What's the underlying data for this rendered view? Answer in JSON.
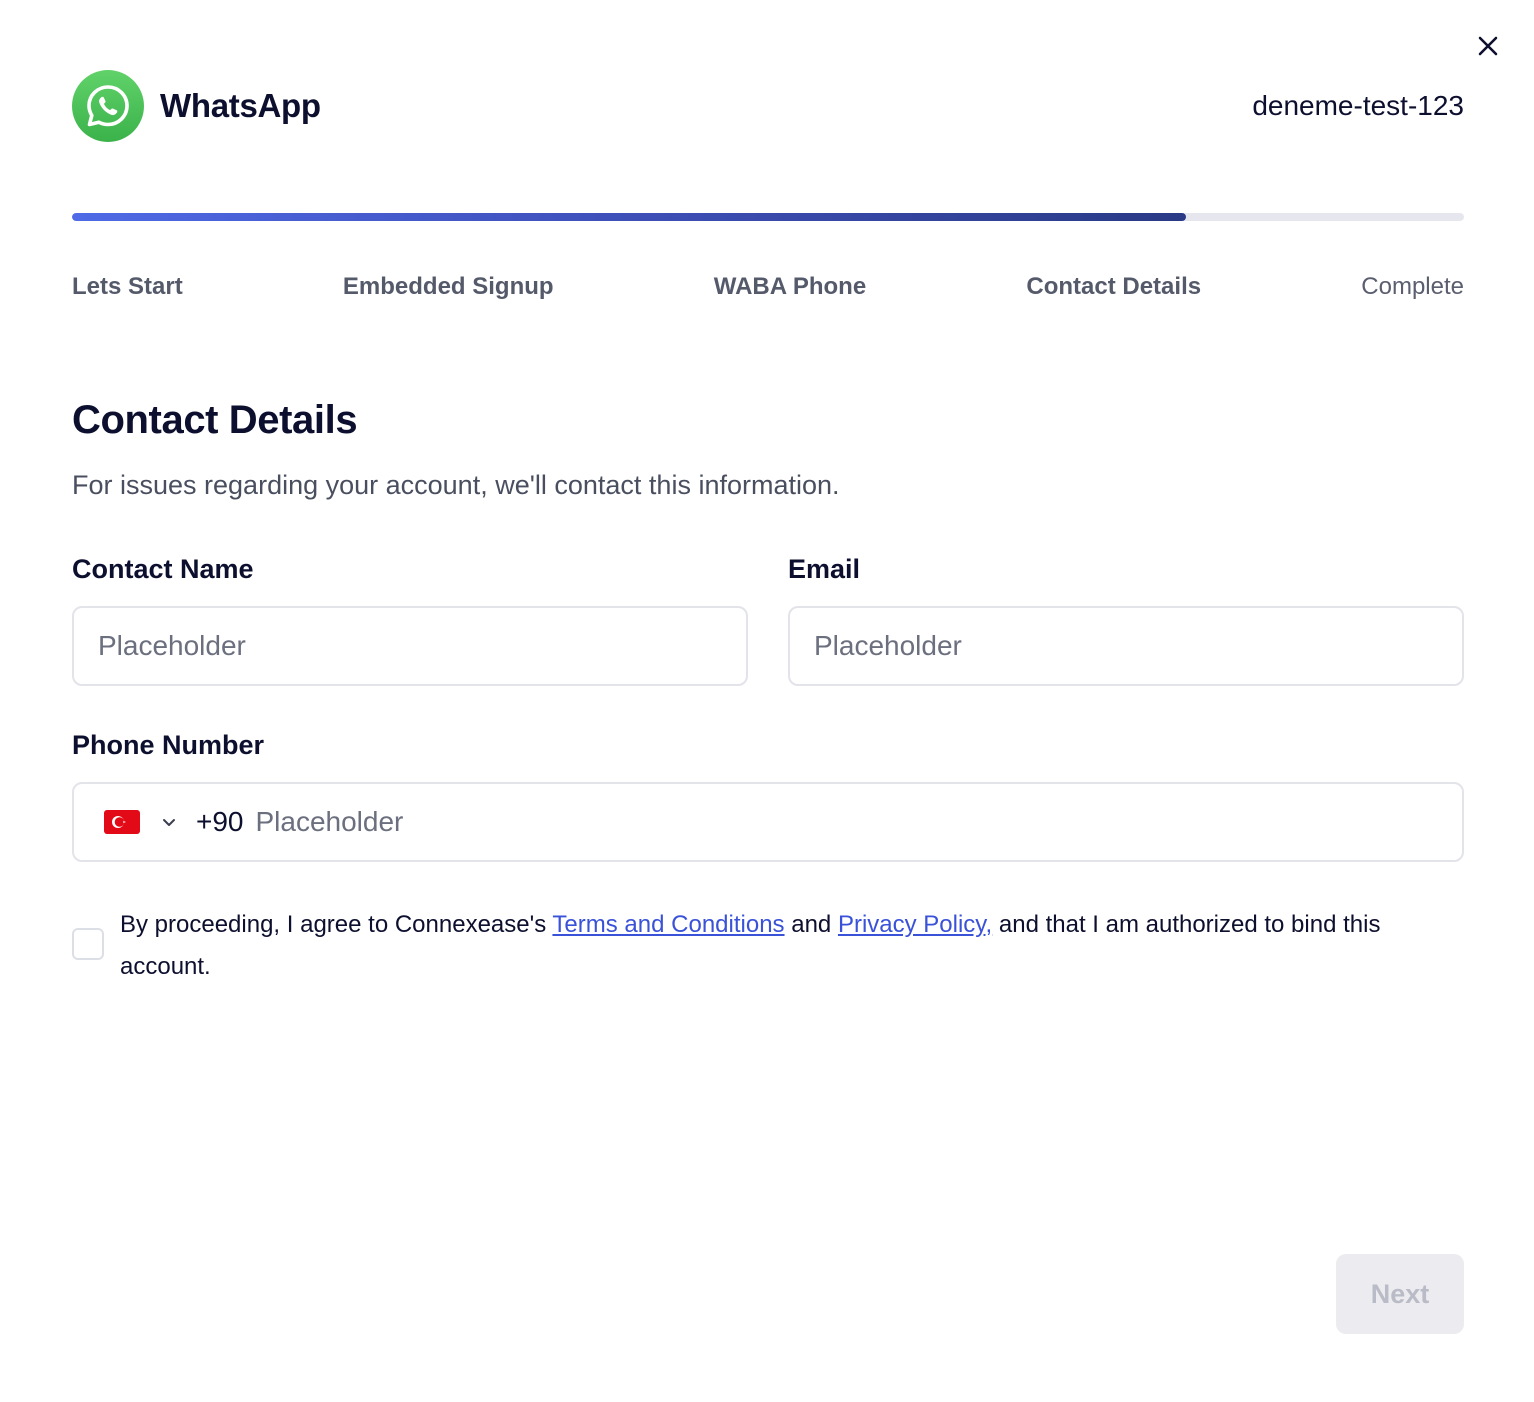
{
  "header": {
    "app_name": "WhatsApp",
    "account_name": "deneme-test-123",
    "logo_icon": "whatsapp-logo-icon",
    "close_icon": "close-icon"
  },
  "progress": {
    "current_step": 4,
    "total_steps": 5,
    "fraction_complete": 0.8,
    "steps": [
      {
        "label": "Lets Start",
        "state": "done"
      },
      {
        "label": "Embedded Signup",
        "state": "done"
      },
      {
        "label": "WABA Phone",
        "state": "done"
      },
      {
        "label": "Contact Details",
        "state": "current"
      },
      {
        "label": "Complete",
        "state": "upcoming"
      }
    ]
  },
  "form": {
    "title": "Contact Details",
    "subtitle": "For issues regarding your account, we'll contact this information.",
    "contact_name": {
      "label": "Contact Name",
      "value": "",
      "placeholder": "Placeholder"
    },
    "email": {
      "label": "Email",
      "value": "",
      "placeholder": "Placeholder"
    },
    "phone": {
      "label": "Phone Number",
      "country_flag": "turkey-flag-icon",
      "dial_code": "+90",
      "value": "",
      "placeholder": "Placeholder"
    },
    "agreement": {
      "checked": false,
      "text_before": "By proceeding, I agree to Connexease's ",
      "terms_link": "Terms and Conditions",
      "text_middle": " and ",
      "privacy_link": "Privacy Policy,",
      "text_after": " and that I am authorized to bind this account."
    }
  },
  "actions": {
    "next_label": "Next",
    "next_enabled": false
  },
  "colors": {
    "progress_start": "#4f6ae6",
    "progress_end": "#2a3a86",
    "link": "#3a52d8",
    "brand_green": "#4cc35a"
  }
}
